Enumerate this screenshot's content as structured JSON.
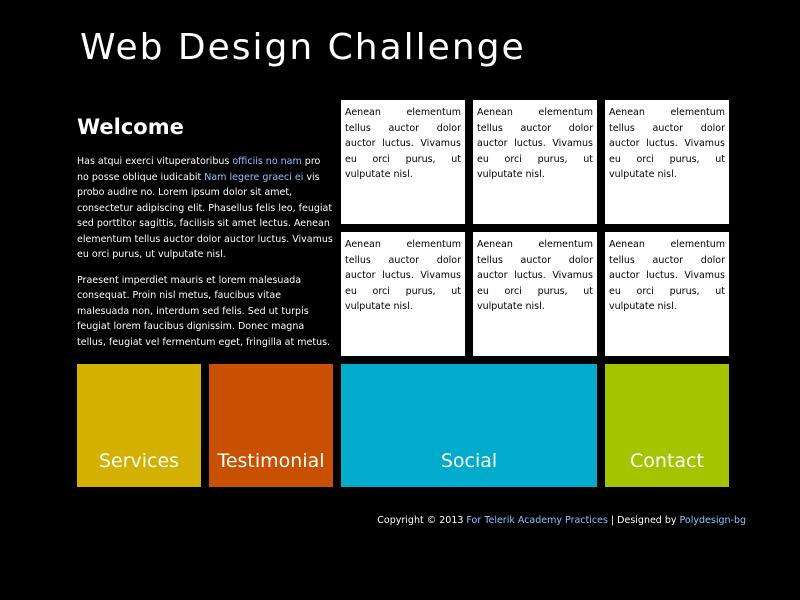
{
  "header": {
    "title": "Web Design Challenge"
  },
  "welcome": {
    "heading": "Welcome",
    "p1_a": "Has atqui exerci vituperatoribus ",
    "p1_link1": "officiis no nam",
    "p1_b": " pro no posse oblique iudicabit ",
    "p1_link2": "Nam legere graeci ei",
    "p1_c": " vis probo audire no. Lorem ipsum dolor sit amet, consectetur adipiscing elit. Phasellus felis leo, feugiat sed porttitor sagittis, facilisis sit amet lectus. Aenean elementum tellus auctor dolor auctor luctus. Vivamus eu orci purus, ut vulputate nisl.",
    "p2": "Praesent imperdiet mauris et lorem malesuada consequat. Proin nisl metus, faucibus vitae malesuada non, interdum sed felis. Sed ut turpis feugiat lorem faucibus dignissim. Donec magna tellus, feugiat vel fermentum eget, fringilla at metus."
  },
  "tiles": [
    "Aenean elementum tellus auctor dolor auctor luctus. Vivamus eu orci purus, ut vulputate nisl.",
    "Aenean elementum tellus auctor dolor auctor luctus. Vivamus eu orci purus, ut vulputate nisl.",
    "Aenean elementum tellus auctor dolor auctor luctus. Vivamus eu orci purus, ut vulputate nisl.",
    "Aenean elementum tellus auctor dolor auctor luctus. Vivamus eu orci purus, ut vulputate nisl.",
    "Aenean elementum tellus auctor dolor auctor luctus. Vivamus eu orci purus, ut vulputate nisl.",
    "Aenean elementum tellus auctor dolor auctor luctus. Vivamus eu orci purus, ut vulputate nisl."
  ],
  "nav": [
    {
      "label": "Services",
      "color": "#d4b000"
    },
    {
      "label": "Testimonial",
      "color": "#c95000"
    },
    {
      "label": "Social",
      "color": "#00abcb"
    },
    {
      "label": "Contact",
      "color": "#a4c400"
    }
  ],
  "footer": {
    "prefix": "Copyright © 2013 ",
    "link1": "For Telerik Academy Practices",
    "middle": " | Designed by ",
    "link2": "Polydesign-bg"
  },
  "colors": {
    "background": "#000000",
    "link": "#8fc3ff",
    "tile": "#ffffff"
  }
}
